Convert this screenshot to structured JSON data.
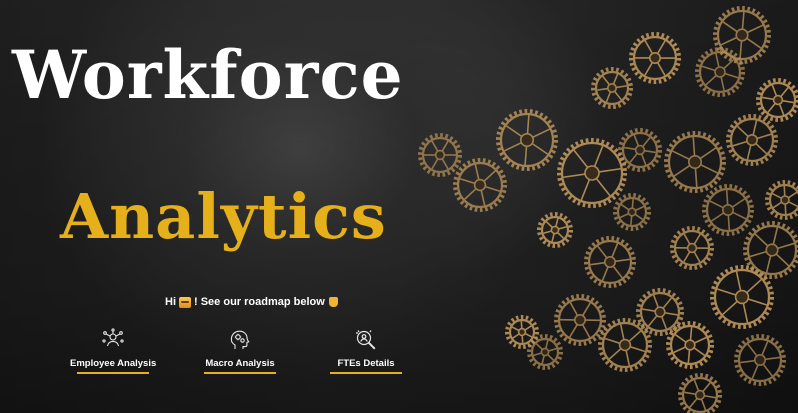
{
  "hero": {
    "title_line1": "Workforce",
    "title_line2": "Analytics",
    "greeting_pre": "Hi",
    "greeting_post": "! See our roadmap below",
    "title_color": "#ffffff",
    "accent_color": "#e5b01a"
  },
  "nav": [
    {
      "label": "Employee Analysis",
      "icon": "people-network-icon"
    },
    {
      "label": "Macro Analysis",
      "icon": "brain-gears-icon"
    },
    {
      "label": "FTEs Details",
      "icon": "magnifier-person-icon"
    }
  ],
  "decor": {
    "gear_color": "#b8925a",
    "background_icon": "gears-cluster"
  }
}
